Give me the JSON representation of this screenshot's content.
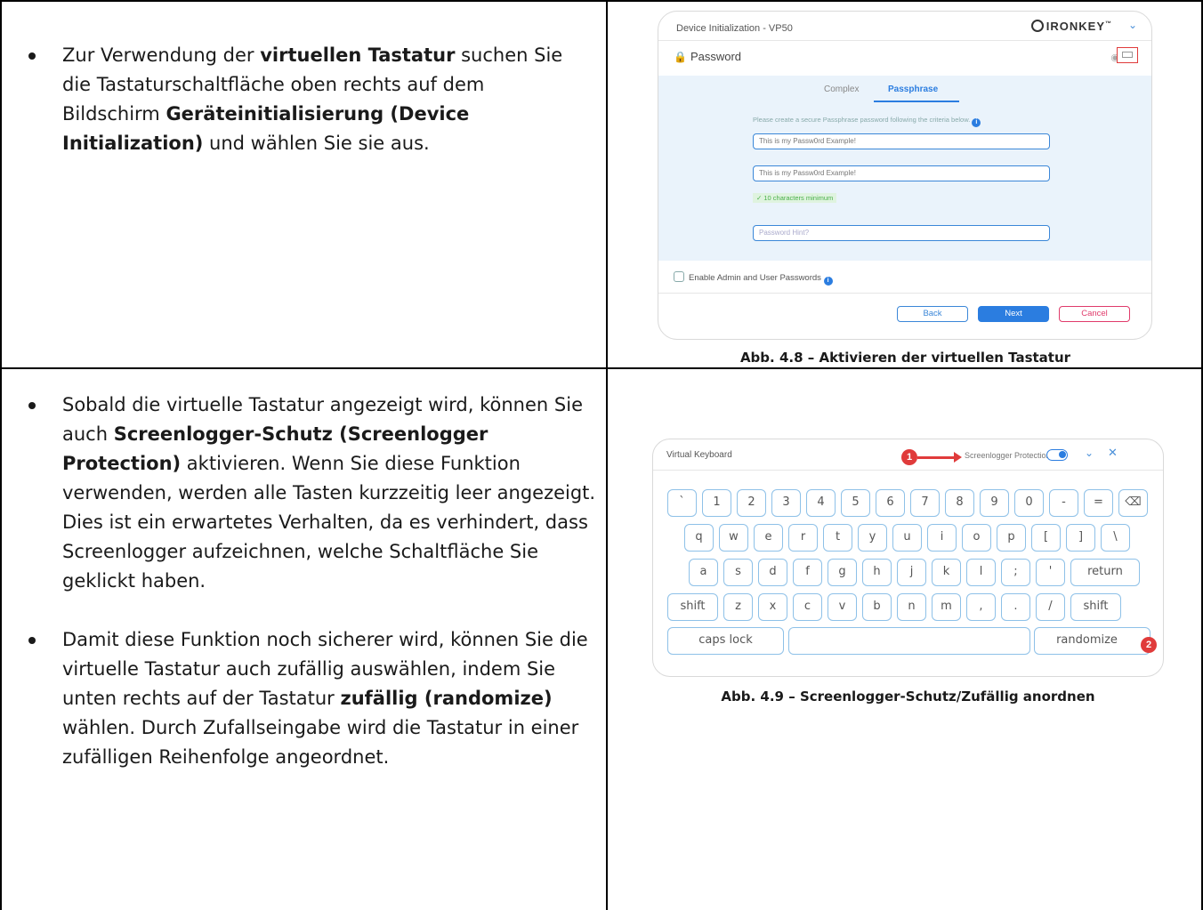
{
  "row1": {
    "bullet_intro": "Zur Verwendung der ",
    "bullet_bold1": "virtuellen Tastatur",
    "bullet_mid1": " suchen Sie die Tastaturschaltfläche oben rechts auf dem Bildschirm ",
    "bullet_bold2": "Geräteinitialisierung (Device Initialization)",
    "bullet_end": " und wählen Sie sie aus.",
    "caption": "Abb. 4.8 – Aktivieren der virtuellen Tastatur"
  },
  "row2": {
    "bullet1_intro": "Sobald die virtuelle Tastatur angezeigt wird, können Sie auch ",
    "bullet1_bold": "Screenlogger-Schutz (Screenlogger Protection)",
    "bullet1_end": " aktivieren. Wenn Sie diese Funktion verwenden, werden alle Tasten kurzzeitig leer angezeigt. Dies ist ein erwartetes Verhalten, da es verhindert, dass Screenlogger aufzeichnen, welche Schaltfläche Sie geklickt haben.",
    "bullet2_intro": "Damit diese Funktion noch sicherer wird, können Sie die virtuelle Tastatur auch zufällig auswählen, indem Sie unten rechts auf der Tastatur ",
    "bullet2_bold": "zufällig (randomize)",
    "bullet2_end": " wählen. Durch Zufallseingabe wird die Tastatur in einer zufälligen Reihenfolge angeordnet.",
    "caption": "Abb. 4.9 – Screenlogger-Schutz/Zufällig anordnen"
  },
  "device_init": {
    "title": "Device Initialization - VP50",
    "brand": "IRONKEY",
    "brand_tm": "™",
    "section": "Password",
    "lock_icon": "lock-icon",
    "tab_complex": "Complex",
    "tab_passphrase": "Passphrase",
    "hint": "Please create a secure Passphrase password following the criteria below.",
    "field1_value": "This is my Passw0rd Example!",
    "field2_value": "This is my Passw0rd Example!",
    "criteria": "✓ 10 characters minimum",
    "hint_placeholder": "Password Hint?",
    "admin_label": "Enable Admin and User Passwords",
    "back": "Back",
    "next": "Next",
    "cancel": "Cancel",
    "accent": "#2b7de0",
    "highlight": "#e03b3b"
  },
  "virtual_keyboard": {
    "title": "Virtual Keyboard",
    "protection_label": "Screenlogger Protection",
    "marker1": "1",
    "marker2": "2",
    "row1": [
      "`",
      "1",
      "2",
      "3",
      "4",
      "5",
      "6",
      "7",
      "8",
      "9",
      "0",
      "-",
      "=",
      "⌫"
    ],
    "row2": [
      "q",
      "w",
      "e",
      "r",
      "t",
      "y",
      "u",
      "i",
      "o",
      "p",
      "[",
      "]",
      "\\"
    ],
    "row3": [
      "a",
      "s",
      "d",
      "f",
      "g",
      "h",
      "j",
      "k",
      "l",
      ";",
      "'",
      "return"
    ],
    "row4": [
      "shift",
      "z",
      "x",
      "c",
      "v",
      "b",
      "n",
      "m",
      ",",
      ".",
      "/",
      "shift"
    ],
    "caps_lock": "caps lock",
    "randomize": "randomize"
  }
}
